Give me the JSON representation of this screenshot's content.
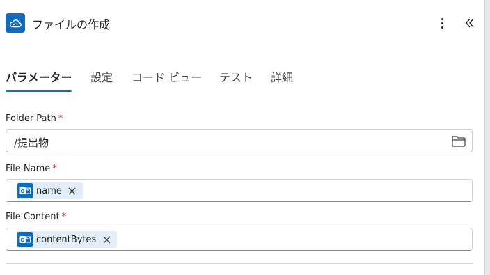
{
  "header": {
    "title": "ファイルの作成",
    "app_icon": "cloud-icon",
    "more_icon": "more-vertical-icon",
    "collapse_icon": "double-chevron-left-icon"
  },
  "tabs": [
    {
      "label": "パラメーター",
      "active": true
    },
    {
      "label": "設定",
      "active": false
    },
    {
      "label": "コード ビュー",
      "active": false
    },
    {
      "label": "テスト",
      "active": false
    },
    {
      "label": "詳細",
      "active": false
    }
  ],
  "fields": {
    "folder_path": {
      "label": "Folder Path",
      "required_mark": "*",
      "value": "/提出物",
      "icon": "folder-icon"
    },
    "file_name": {
      "label": "File Name",
      "required_mark": "*",
      "token": "name",
      "token_icon": "outlook-icon"
    },
    "file_content": {
      "label": "File Content",
      "required_mark": "*",
      "token": "contentBytes",
      "token_icon": "outlook-icon"
    }
  },
  "colors": {
    "accent": "#0f6cbd",
    "required": "#c4314b",
    "token_bg": "#e1eefa"
  }
}
